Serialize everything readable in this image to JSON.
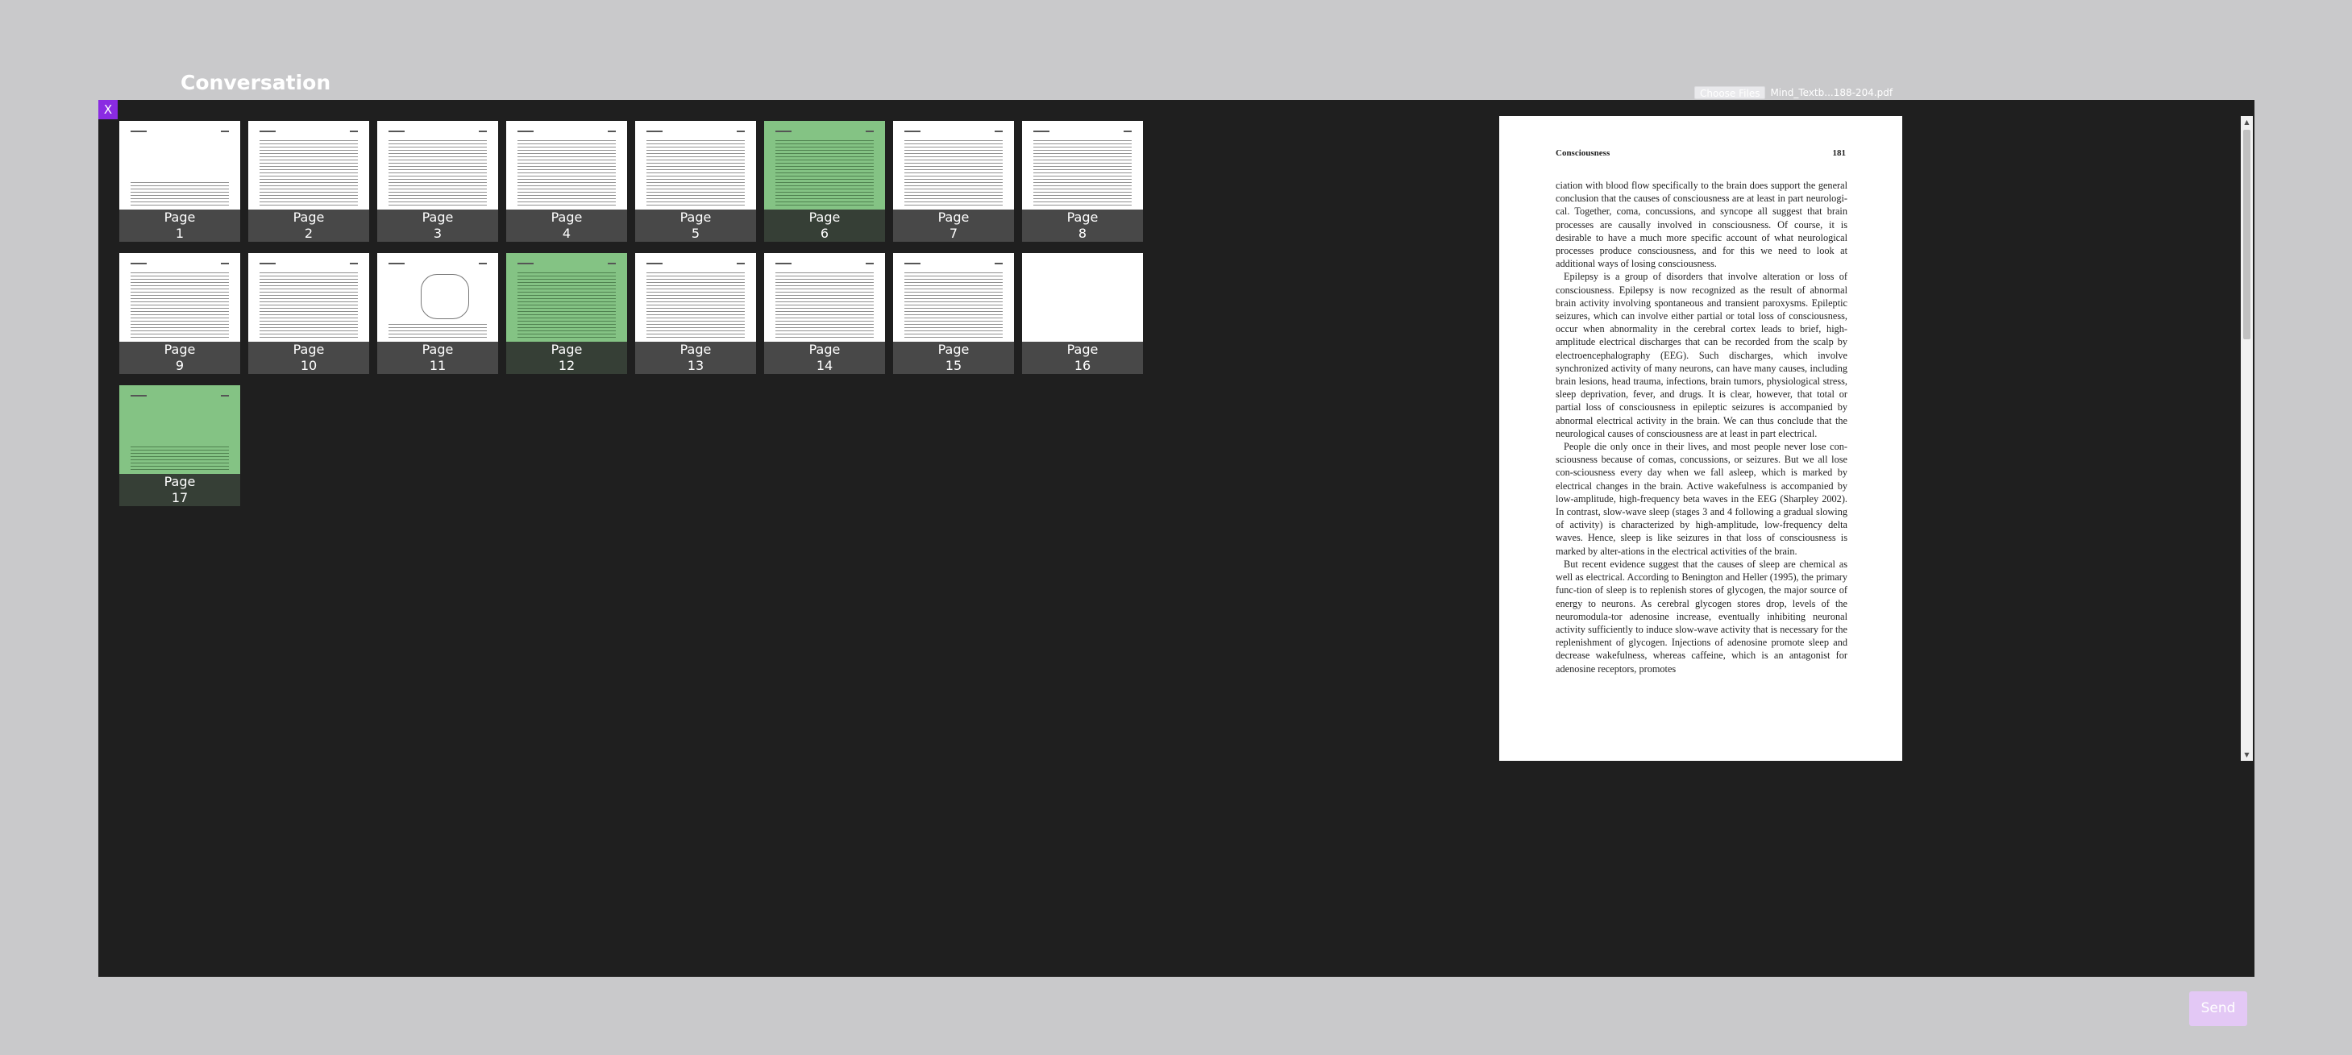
{
  "app": {
    "title": "Conversation"
  },
  "file_picker": {
    "button_label": "Choose Files",
    "file_name": "Mind_Textb...188-204.pdf"
  },
  "modal": {
    "close_label": "X"
  },
  "thumbnails": [
    {
      "line1": "Page",
      "line2": "1",
      "selected": false
    },
    {
      "line1": "Page",
      "line2": "2",
      "selected": false
    },
    {
      "line1": "Page",
      "line2": "3",
      "selected": false
    },
    {
      "line1": "Page",
      "line2": "4",
      "selected": false
    },
    {
      "line1": "Page",
      "line2": "5",
      "selected": false
    },
    {
      "line1": "Page",
      "line2": "6",
      "selected": true
    },
    {
      "line1": "Page",
      "line2": "7",
      "selected": false
    },
    {
      "line1": "Page",
      "line2": "8",
      "selected": false
    },
    {
      "line1": "Page",
      "line2": "9",
      "selected": false
    },
    {
      "line1": "Page",
      "line2": "10",
      "selected": false
    },
    {
      "line1": "Page",
      "line2": "11",
      "selected": false
    },
    {
      "line1": "Page",
      "line2": "12",
      "selected": true
    },
    {
      "line1": "Page",
      "line2": "13",
      "selected": false
    },
    {
      "line1": "Page",
      "line2": "14",
      "selected": false
    },
    {
      "line1": "Page",
      "line2": "15",
      "selected": false
    },
    {
      "line1": "Page",
      "line2": "16",
      "selected": false
    },
    {
      "line1": "Page",
      "line2": "17",
      "selected": true
    }
  ],
  "preview": {
    "header_left": "Consciousness",
    "header_right": "181",
    "paragraphs": [
      "ciation with blood flow specifically to the brain does support the general conclusion that the causes of consciousness are at least in part neurologi-cal. Together, coma, concussions, and syncope all suggest that brain processes are causally involved in consciousness. Of course, it is desirable to have a much more specific account of what neurological processes produce consciousness, and for this we need to look at additional ways of losing consciousness.",
      "Epilepsy is a group of disorders that involve alteration or loss of consciousness. Epilepsy is now recognized as the result of abnormal brain activity involving spontaneous and transient paroxysms. Epileptic seizures, which can involve either partial or total loss of consciousness, occur when abnormality in the cerebral cortex leads to brief, high-amplitude electrical discharges that can be recorded from the scalp by electroencephalography (EEG). Such discharges, which involve synchronized activity of many neurons, can have many causes, including brain lesions, head trauma, infections, brain tumors, physiological stress, sleep deprivation, fever, and drugs. It is clear, however, that total or partial loss of consciousness in epileptic seizures is accompanied by abnormal electrical activity in the brain. We can thus conclude that the neurological causes of consciousness are at least in part electrical.",
      "People die only once in their lives, and most people never lose con-sciousness because of comas, concussions, or seizures. But we all lose con-sciousness every day when we fall asleep, which is marked by electrical changes in the brain. Active wakefulness is accompanied by low-amplitude, high-frequency beta waves in the EEG (Sharpley 2002). In contrast, slow-wave sleep (stages 3 and 4 following a gradual slowing of activity) is characterized by high-amplitude, low-frequency delta waves. Hence, sleep is like seizures in that loss of consciousness is marked by alter-ations in the electrical activities of the brain.",
      "But recent evidence suggest that the causes of sleep are chemical as well as electrical. According to Benington and Heller (1995), the primary func-tion of sleep is to replenish stores of glycogen, the major source of energy to neurons. As cerebral glycogen stores drop, levels of the neuromodula-tor adenosine increase, eventually inhibiting neuronal activity sufficiently to induce slow-wave activity that is necessary for the replenishment of glycogen. Injections of adenosine promote sleep and decrease wakefulness, whereas caffeine, which is an antagonist for adenosine receptors, promotes"
    ]
  },
  "send": {
    "label": "Send"
  },
  "colors": {
    "selected_thumb": "#84c384",
    "close_button": "#8a2be2",
    "send_button": "#e3c8f5",
    "modal_bg": "#1f1f1f"
  }
}
